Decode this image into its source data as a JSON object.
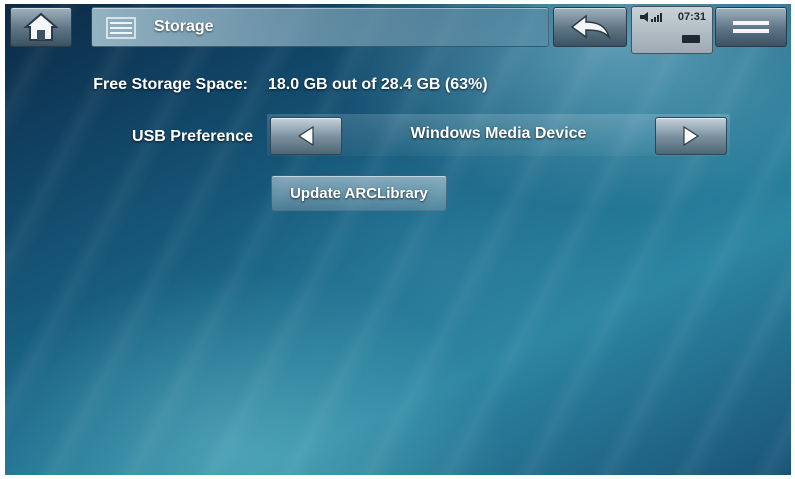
{
  "header": {
    "title": "Storage",
    "clock": "07:31",
    "icons": {
      "home": "home-icon",
      "list": "list-icon",
      "back": "back-arrow-icon",
      "menu": "menu-icon",
      "signal": "volume-signal-icon",
      "battery": "battery-icon"
    }
  },
  "storage": {
    "free_label": "Free Storage Space:",
    "free_value": "18.0 GB out of 28.4 GB (63%)"
  },
  "usb": {
    "label": "USB Preference",
    "value": "Windows Media Device"
  },
  "actions": {
    "update_label": "Update ARCLibrary"
  },
  "colors": {
    "background_top": "#0b2a45",
    "background_mid": "#1c6a8a",
    "text": "#ffffff"
  }
}
